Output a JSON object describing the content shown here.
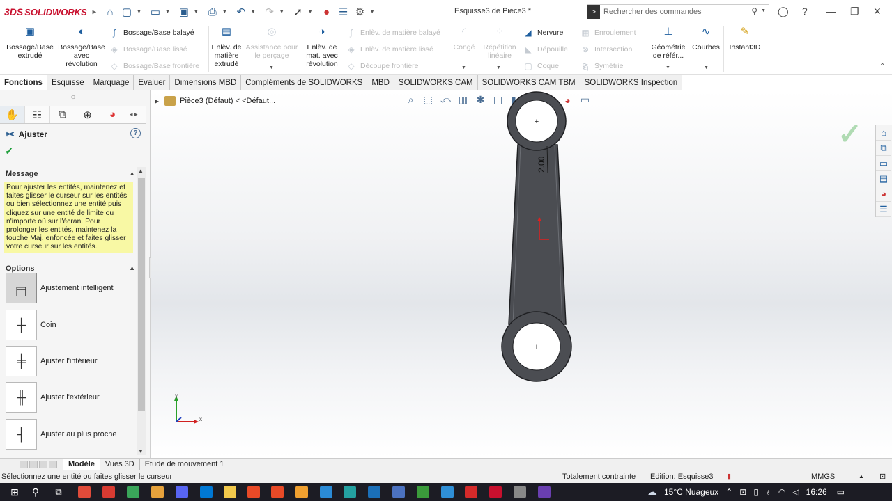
{
  "app": {
    "brand": "SOLIDWORKS",
    "doc_title": "Esquisse3 de Pièce3 *"
  },
  "search": {
    "placeholder": "Rechercher des commandes"
  },
  "ribbon": {
    "extrude": "Bossage/Base extrudé",
    "revolve": "Bossage/Base avec révolution",
    "sweep": "Bossage/Base balayé",
    "loft": "Bossage/Base lissé",
    "boundary": "Bossage/Base frontière",
    "cut_extrude": "Enlèv. de matière extrudé",
    "hole_wizard": "Assistance pour le perçage",
    "cut_revolve": "Enlèv. de mat. avec révolution",
    "cut_sweep": "Enlèv. de matière balayé",
    "cut_loft": "Enlèv. de matière lissé",
    "cut_boundary": "Découpe frontière",
    "fillet": "Congé",
    "pattern": "Répétition linéaire",
    "rib": "Nervure",
    "draft": "Dépouille",
    "shell": "Coque",
    "wrap": "Enroulement",
    "intersect": "Intersection",
    "mirror": "Symétrie",
    "ref_geometry": "Géométrie de référ...",
    "curves": "Courbes",
    "instant3d": "Instant3D"
  },
  "cmd_tabs": [
    "Fonctions",
    "Esquisse",
    "Marquage",
    "Evaluer",
    "Dimensions MBD",
    "Compléments de SOLIDWORKS",
    "MBD",
    "SOLIDWORKS CAM",
    "SOLIDWORKS CAM TBM",
    "SOLIDWORKS Inspection"
  ],
  "tree": {
    "crumb": "Pièce3 (Défaut) < <Défaut..."
  },
  "sketch": {
    "dimension": "2.00"
  },
  "triad": {
    "x": "x",
    "y": "y"
  },
  "property_manager": {
    "title": "Ajuster",
    "message_header": "Message",
    "message": "Pour ajuster les entités, maintenez et faites glisser le curseur sur les entités ou bien sélectionnez une entité puis cliquez sur une entité de limite ou n'importe où sur l'écran. Pour prolonger les entités, maintenez la touche Maj. enfoncée et faites glisser votre curseur sur les entités.",
    "options_header": "Options",
    "options": [
      {
        "label": "Ajustement intelligent",
        "active": true
      },
      {
        "label": "Coin",
        "active": false
      },
      {
        "label": "Ajuster l'intérieur",
        "active": false
      },
      {
        "label": "Ajuster l'extérieur",
        "active": false
      },
      {
        "label": "Ajuster au plus proche",
        "active": false
      }
    ]
  },
  "bottom_tabs": [
    "Modèle",
    "Vues 3D",
    "Etude de mouvement 1"
  ],
  "status": {
    "left": "Sélectionnez une entité ou faites glisser le curseur",
    "constraint": "Totalement contrainte",
    "edition": "Edition: Esquisse3",
    "units": "MMGS"
  },
  "taskbar": {
    "weather": "15°C Nuageux",
    "time": "16:26",
    "colors": [
      "#e04b3a",
      "#d83b32",
      "#3aa55a",
      "#e6a23c",
      "#5865f2",
      "#0078d4",
      "#f2c94c",
      "#e84a27",
      "#e84a27",
      "#f0a030",
      "#2b8bd6",
      "#24a0a0",
      "#1b6fb8",
      "#4c72c0",
      "#3b9b3b",
      "#2f8fd6",
      "#d42a2a",
      "#c8102e",
      "#888888",
      "#6a3fb0"
    ]
  }
}
